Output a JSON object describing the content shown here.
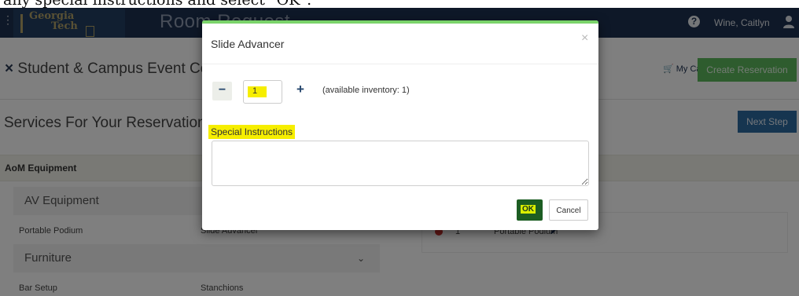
{
  "caption": "any special instructions and select \"OK\".",
  "header": {
    "logo_line1": "Georgia",
    "logo_line2": "Tech",
    "app_title": "Room Request",
    "help_icon": "question-circle-icon",
    "user_name": "Wine, Caitlyn",
    "user_icon": "user-icon"
  },
  "location": {
    "close_mark": "×",
    "name": "Student & Campus Event Cen",
    "cart_label": "My Cart (2)",
    "create_button": "Create Reservation"
  },
  "services": {
    "title": "Services For Your Reservation",
    "next_button": "Next Step",
    "section": "AoM Equipment",
    "groups": [
      {
        "label": "AV Equipment",
        "items": [
          "Portable Podium",
          "Slide Advancer"
        ]
      },
      {
        "label": "Furniture",
        "items": [
          "Bar Setup",
          "Stanchions"
        ]
      }
    ]
  },
  "cart_items": [
    {
      "qty": "1",
      "name": "Portable Podium"
    }
  ],
  "modal": {
    "title": "Slide Advancer",
    "close": "×",
    "quantity": "1",
    "minus_label": "−",
    "plus_label": "+",
    "available": "(available inventory: 1)",
    "special_label": "Special Instructions",
    "special_value": "",
    "ok_button": "OK",
    "cancel_button": "Cancel"
  },
  "colors": {
    "header": "#1d3150",
    "create": "#5cb85c",
    "next": "#2c6aa0",
    "highlight": "#f6ee00",
    "modal_accent": "#7ad36a"
  }
}
